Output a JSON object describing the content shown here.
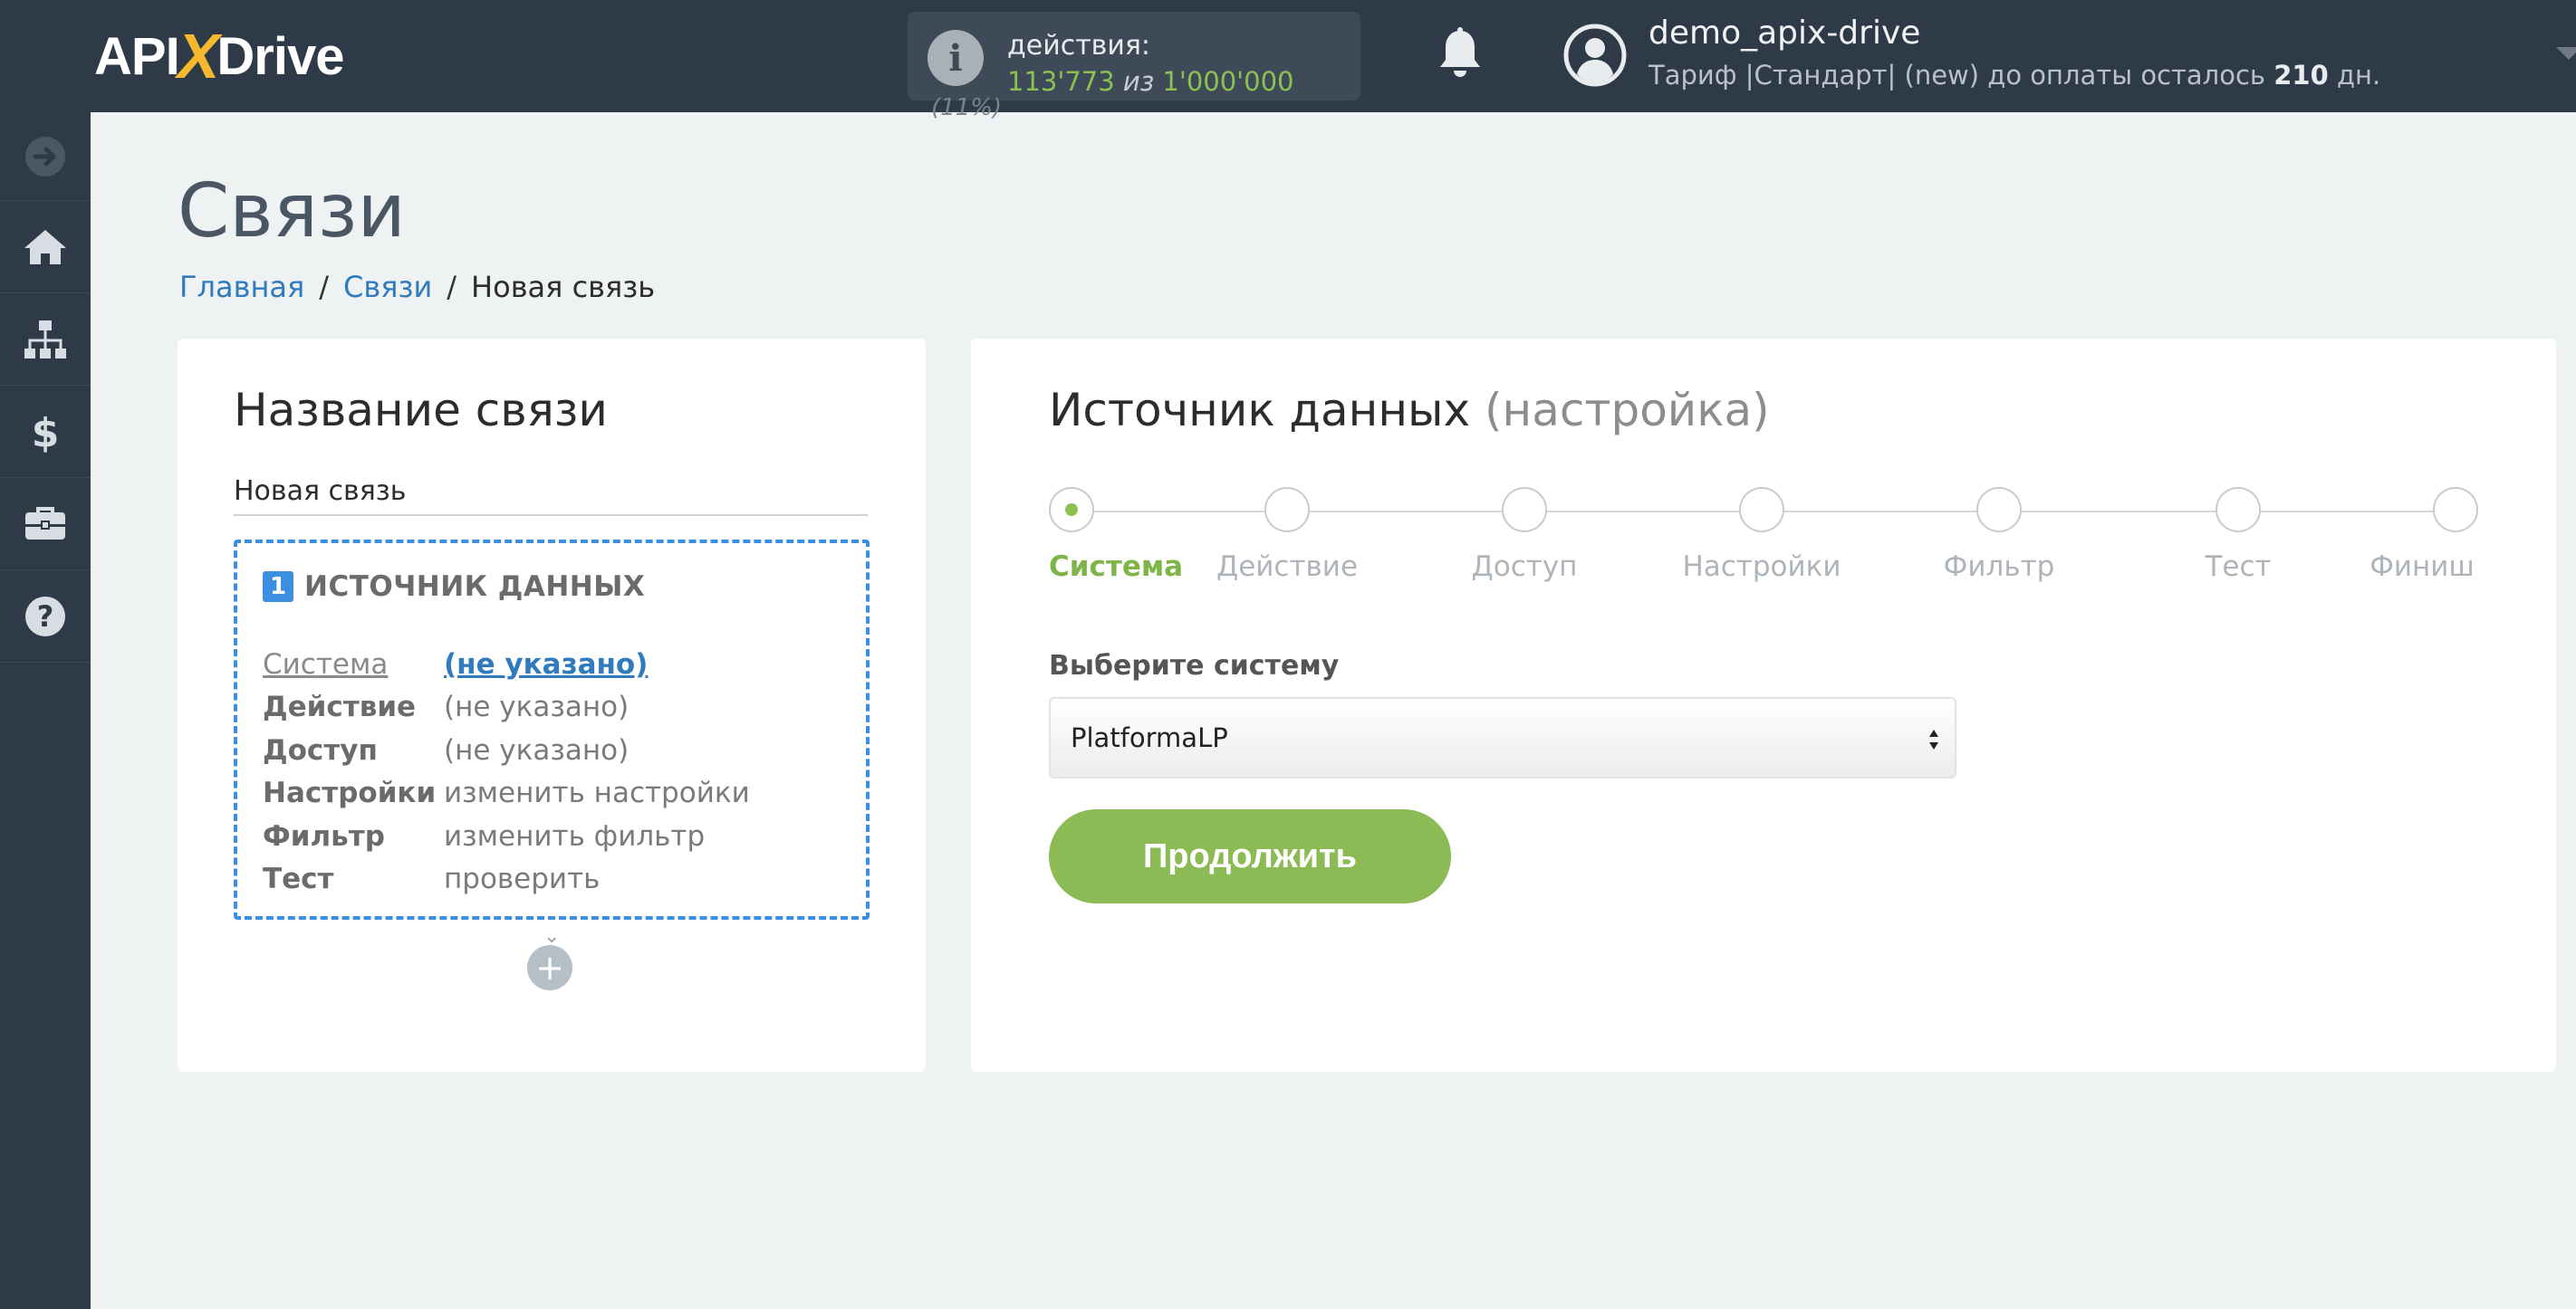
{
  "header": {
    "logo": {
      "part1": "API",
      "x": "X",
      "part2": "Drive"
    },
    "actions": {
      "label": "действия:",
      "used": "113'773",
      "of": "из",
      "total": "1'000'000",
      "percent": "(11%)"
    },
    "bell_icon": "bell-icon",
    "user": {
      "name": "demo_apix-drive",
      "plan_prefix": "Тариф |Стандарт| (new) до оплаты осталось",
      "days": "210",
      "days_suffix": "дн."
    }
  },
  "sidebar": {
    "items": [
      {
        "icon": "arrow-right-circle-icon"
      },
      {
        "icon": "home-icon"
      },
      {
        "icon": "sitemap-icon"
      },
      {
        "icon": "dollar-icon"
      },
      {
        "icon": "briefcase-icon"
      },
      {
        "icon": "help-circle-icon"
      }
    ]
  },
  "page": {
    "title": "Связи",
    "breadcrumb": {
      "home": "Главная",
      "links": "Связи",
      "current": "Новая связь"
    }
  },
  "left_card": {
    "title": "Название связи",
    "name_value": "Новая связь",
    "source": {
      "number": "1",
      "label": "ИСТОЧНИК ДАННЫХ",
      "rows": [
        {
          "key": "Система",
          "value": "(не указано)"
        },
        {
          "key": "Действие",
          "value": "(не указано)"
        },
        {
          "key": "Доступ",
          "value": "(не указано)"
        },
        {
          "key": "Настройки",
          "value": "изменить настройки"
        },
        {
          "key": "Фильтр",
          "value": "изменить фильтр"
        },
        {
          "key": "Тест",
          "value": "проверить"
        }
      ]
    },
    "add_symbol": "+"
  },
  "right_card": {
    "title": "Источник данных",
    "title_muted": "(настройка)",
    "steps": [
      "Система",
      "Действие",
      "Доступ",
      "Настройки",
      "Фильтр",
      "Тест",
      "Финиш"
    ],
    "active_step": 0,
    "select_label": "Выберите систему",
    "select_value": "PlatformaLP",
    "continue_label": "Продолжить"
  },
  "colors": {
    "topbar": "#2e3a48",
    "accent_green": "#8cc152",
    "link_blue": "#2f7bbd",
    "dashed_blue": "#3b8ee0"
  }
}
